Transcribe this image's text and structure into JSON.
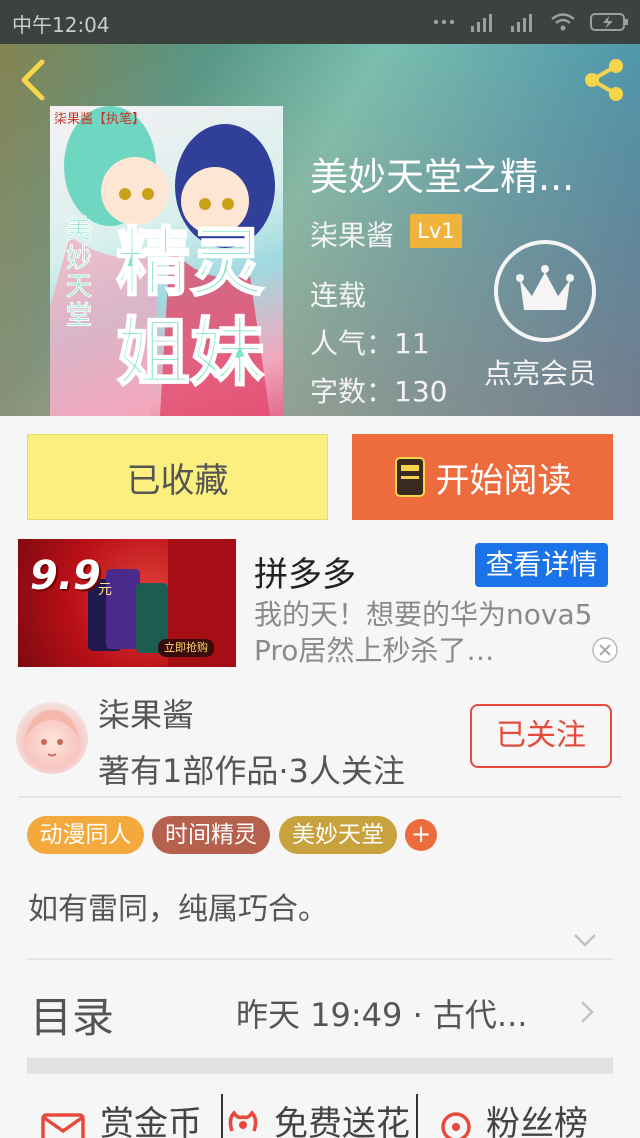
{
  "status_bar": {
    "time": "中午12:04"
  },
  "book": {
    "title": "美妙天堂之精...",
    "author": "柒果酱",
    "level": "Lv1",
    "status": "连载",
    "popularity": "人气：11",
    "word_count": "字数：130",
    "vip_label": "点亮会员",
    "cover": {
      "tag": "柒果酱【执笔】",
      "title_line1": "精灵",
      "title_line2": "姐妹",
      "subtitle": "美妙天堂"
    }
  },
  "actions": {
    "collected_label": "已收藏",
    "read_label": "开始阅读"
  },
  "ad": {
    "price": "9.9",
    "price_unit": "元",
    "buy_label": "立即抢购",
    "name": "拼多多",
    "detail_button": "查看详情",
    "description": "我的天！想要的华为nova5 Pro居然上秒杀了…"
  },
  "author_card": {
    "name": "柒果酱",
    "stats": "著有1部作品·3人关注",
    "follow_label": "已关注"
  },
  "tags": [
    {
      "label": "动漫同人",
      "color": "#f3a93b"
    },
    {
      "label": "时间精灵",
      "color": "#b5614e"
    },
    {
      "label": "美妙天堂",
      "color": "#c8a23c"
    }
  ],
  "tag_add_label": "+",
  "description": "如有雷同，纯属巧合。",
  "toc": {
    "label": "目录",
    "update": "昨天 19:49 · 古代..."
  },
  "bottom_actions": {
    "reward_label": "赏金币",
    "flower_label": "免费送花",
    "fans_label": "粉丝榜"
  },
  "colors": {
    "accent_orange": "#ee6b3e",
    "collected_yellow": "#fbf07f",
    "follow_red": "#e64a3c",
    "ad_blue": "#1a73e8",
    "level_badge": "#f0b43c",
    "icon_yellow": "#f6d54a"
  },
  "icons": {
    "back": "back-arrow-icon",
    "share": "share-icon",
    "vip": "crown-icon",
    "book": "book-icon",
    "close": "close-icon",
    "expand": "chevron-down-icon",
    "toc_arrow": "chevron-right-icon",
    "reward": "envelope-icon",
    "flower": "flower-icon",
    "fans": "rank-icon"
  }
}
